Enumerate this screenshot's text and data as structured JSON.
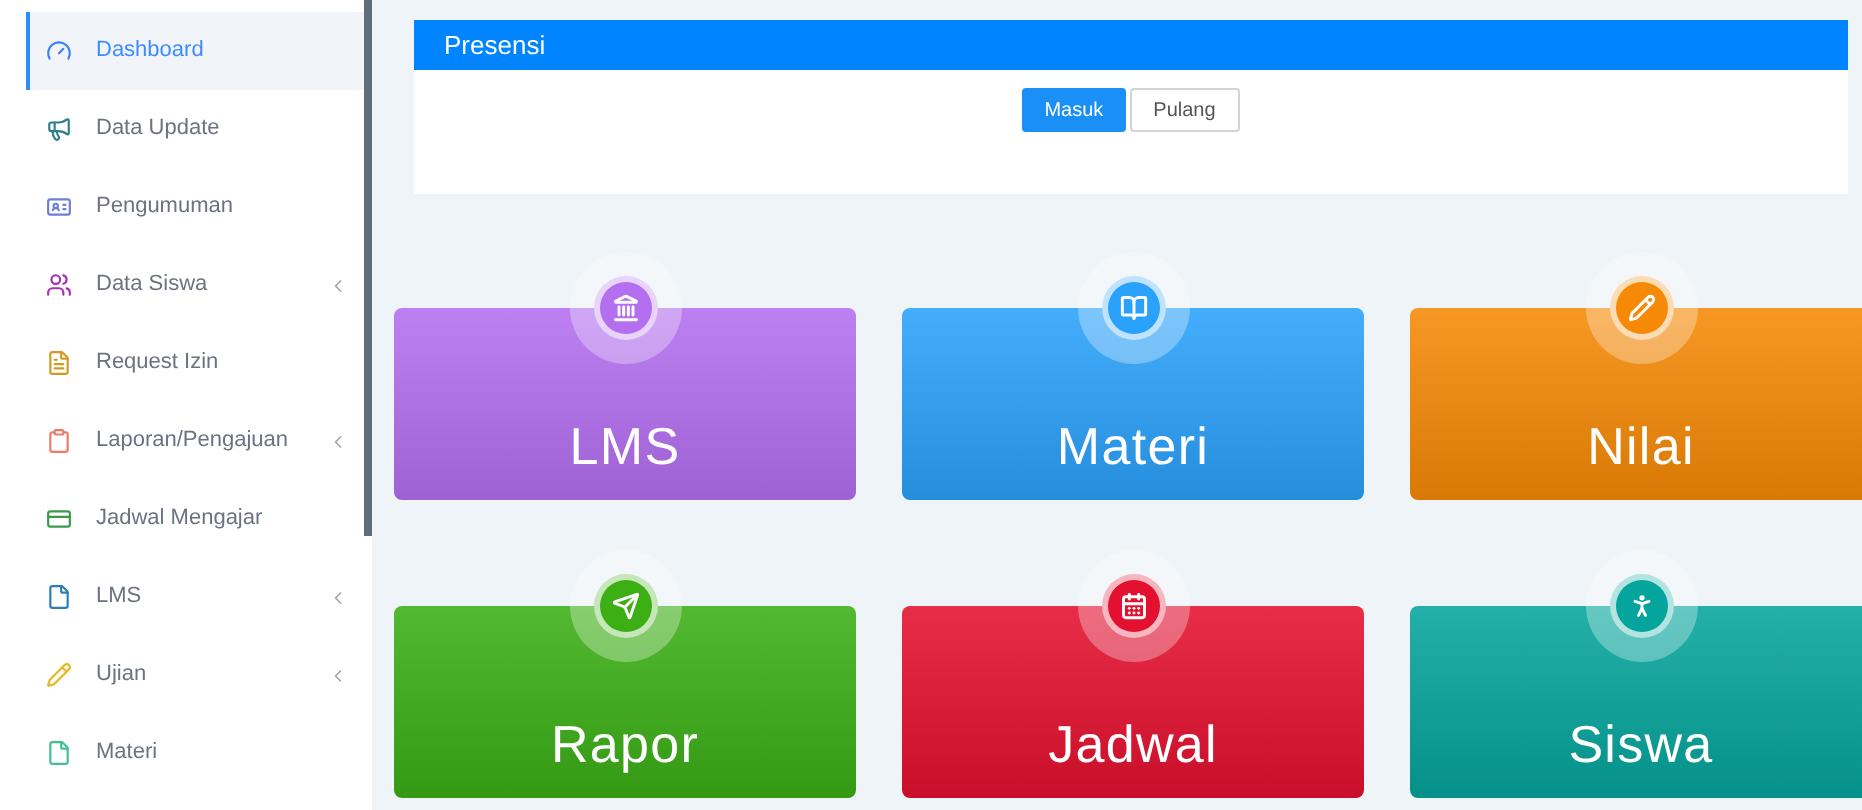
{
  "sidebar": {
    "items": [
      {
        "label": "Dashboard",
        "selected": true,
        "has_submenu": false
      },
      {
        "label": "Data Update",
        "selected": false,
        "has_submenu": false
      },
      {
        "label": "Pengumuman",
        "selected": false,
        "has_submenu": false
      },
      {
        "label": "Data Siswa",
        "selected": false,
        "has_submenu": true
      },
      {
        "label": "Request Izin",
        "selected": false,
        "has_submenu": false
      },
      {
        "label": "Laporan/Pengajuan",
        "selected": false,
        "has_submenu": true
      },
      {
        "label": "Jadwal Mengajar",
        "selected": false,
        "has_submenu": false
      },
      {
        "label": "LMS",
        "selected": false,
        "has_submenu": true
      },
      {
        "label": "Ujian",
        "selected": false,
        "has_submenu": true
      },
      {
        "label": "Materi",
        "selected": false,
        "has_submenu": false
      }
    ]
  },
  "presensi": {
    "title": "Presensi",
    "buttons": [
      {
        "label": "Masuk",
        "selected": true
      },
      {
        "label": "Pulang",
        "selected": false
      }
    ]
  },
  "tiles": [
    {
      "label": "LMS",
      "color": "#b36ff0"
    },
    {
      "label": "Materi",
      "color": "#2aa2fb"
    },
    {
      "label": "Nilai",
      "color": "#f68a06"
    },
    {
      "label": "Rapor",
      "color": "#3caf15"
    },
    {
      "label": "Jadwal",
      "color": "#e4102f"
    },
    {
      "label": "Siswa",
      "color": "#05a59d"
    }
  ]
}
